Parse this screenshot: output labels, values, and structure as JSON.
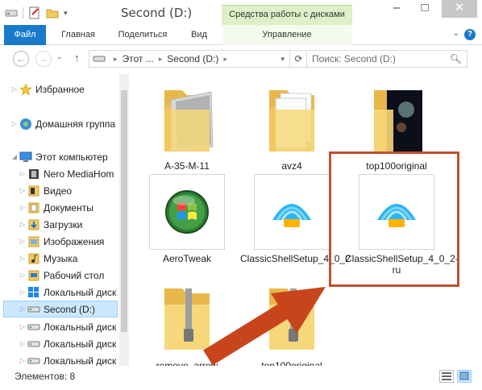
{
  "window": {
    "title": "Second (D:)",
    "context_tab": "Средства работы с дисками",
    "minimize": "–",
    "maximize": "□",
    "close": "✕"
  },
  "ribbon": {
    "tabs": [
      "Файл",
      "Главная",
      "Поделиться",
      "Вид",
      "Управление"
    ],
    "help": "?",
    "collapse": "⌄"
  },
  "address": {
    "back": "←",
    "forward": "→",
    "dropdown": "⌄",
    "up": "↑",
    "segments": [
      "Этот ...",
      "Second (D:)"
    ],
    "refresh": "⟳",
    "search_placeholder": "Поиск: Second (D:)"
  },
  "nav": {
    "favorites": "Избранное",
    "homegroup": "Домашняя группа",
    "this_pc": "Этот компьютер",
    "children": [
      {
        "label": "Nero MediaHom",
        "icon": "nero-icon"
      },
      {
        "label": "Видео",
        "icon": "video-folder-icon"
      },
      {
        "label": "Документы",
        "icon": "documents-folder-icon"
      },
      {
        "label": "Загрузки",
        "icon": "downloads-folder-icon"
      },
      {
        "label": "Изображения",
        "icon": "pictures-folder-icon"
      },
      {
        "label": "Музыка",
        "icon": "music-folder-icon"
      },
      {
        "label": "Рабочий стол",
        "icon": "desktop-folder-icon"
      },
      {
        "label": "Локальный диск",
        "icon": "windows-drive-icon"
      },
      {
        "label": "Second (D:)",
        "icon": "drive-icon"
      },
      {
        "label": "Локальный диск",
        "icon": "drive-icon"
      },
      {
        "label": "Локальный диск",
        "icon": "drive-icon"
      },
      {
        "label": "Локальный диск",
        "icon": "drive-icon"
      }
    ]
  },
  "files": [
    {
      "name": "A-35-M-11",
      "type": "folder-photo"
    },
    {
      "name": "avz4",
      "type": "folder-docs"
    },
    {
      "name": "top100original",
      "type": "folder-space"
    },
    {
      "name": "AeroTweak",
      "type": "aerotweak"
    },
    {
      "name": "ClassicShellSetup_4_0_2",
      "type": "shell"
    },
    {
      "name": "ClassicShellSetup_4_0_2-ru",
      "type": "shell"
    },
    {
      "name": "remove_arrow",
      "type": "zip"
    },
    {
      "name": "top100original",
      "type": "zip"
    }
  ],
  "status": {
    "items_count": "Элементов: 8"
  },
  "colors": {
    "accent": "#1979ca",
    "highlight": "#c0512b",
    "context_tab": "#dff0c8",
    "selection": "#cce8ff"
  }
}
